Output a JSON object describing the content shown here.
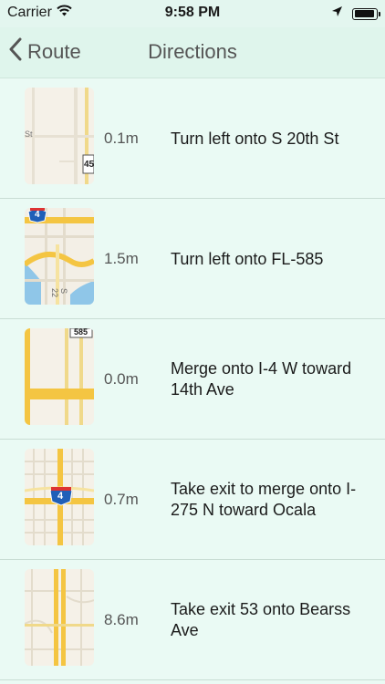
{
  "status": {
    "carrier": "Carrier",
    "time": "9:58 PM"
  },
  "nav": {
    "back_label": "Route",
    "title": "Directions"
  },
  "steps": [
    {
      "distance": "0.1m",
      "instruction": "Turn left onto S 20th St"
    },
    {
      "distance": "1.5m",
      "instruction": "Turn left onto FL-585"
    },
    {
      "distance": "0.0m",
      "instruction": "Merge onto I-4 W toward 14th Ave"
    },
    {
      "distance": "0.7m",
      "instruction": "Take exit to merge onto I-275 N toward Ocala"
    },
    {
      "distance": "8.6m",
      "instruction": "Take exit 53 onto Bearss Ave"
    }
  ],
  "map_labels": {
    "step1_street": "St",
    "step1_shield": "45",
    "step2_shield": "4",
    "step2_street": "S 22",
    "step3_shield": "585",
    "step4_shield": "4"
  },
  "colors": {
    "background": "#eafaf4",
    "nav": "#dff5ec",
    "road": "#f4c542",
    "interstate": "#1f5fb8",
    "water": "#8fc6e8"
  }
}
